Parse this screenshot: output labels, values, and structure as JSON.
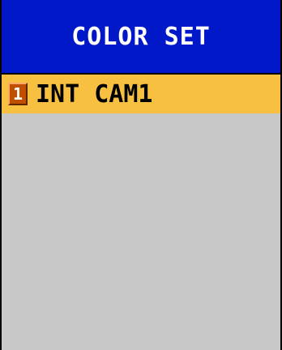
{
  "header": {
    "title": "COLOR SET"
  },
  "list": {
    "items": [
      {
        "number": "1",
        "label": "INT CAM1",
        "selected": true
      }
    ]
  },
  "colors": {
    "header_bg": "#0018c8",
    "selected_bg": "#f8c040",
    "list_bg": "#c8c8c8",
    "badge_bg": "#c05000"
  }
}
